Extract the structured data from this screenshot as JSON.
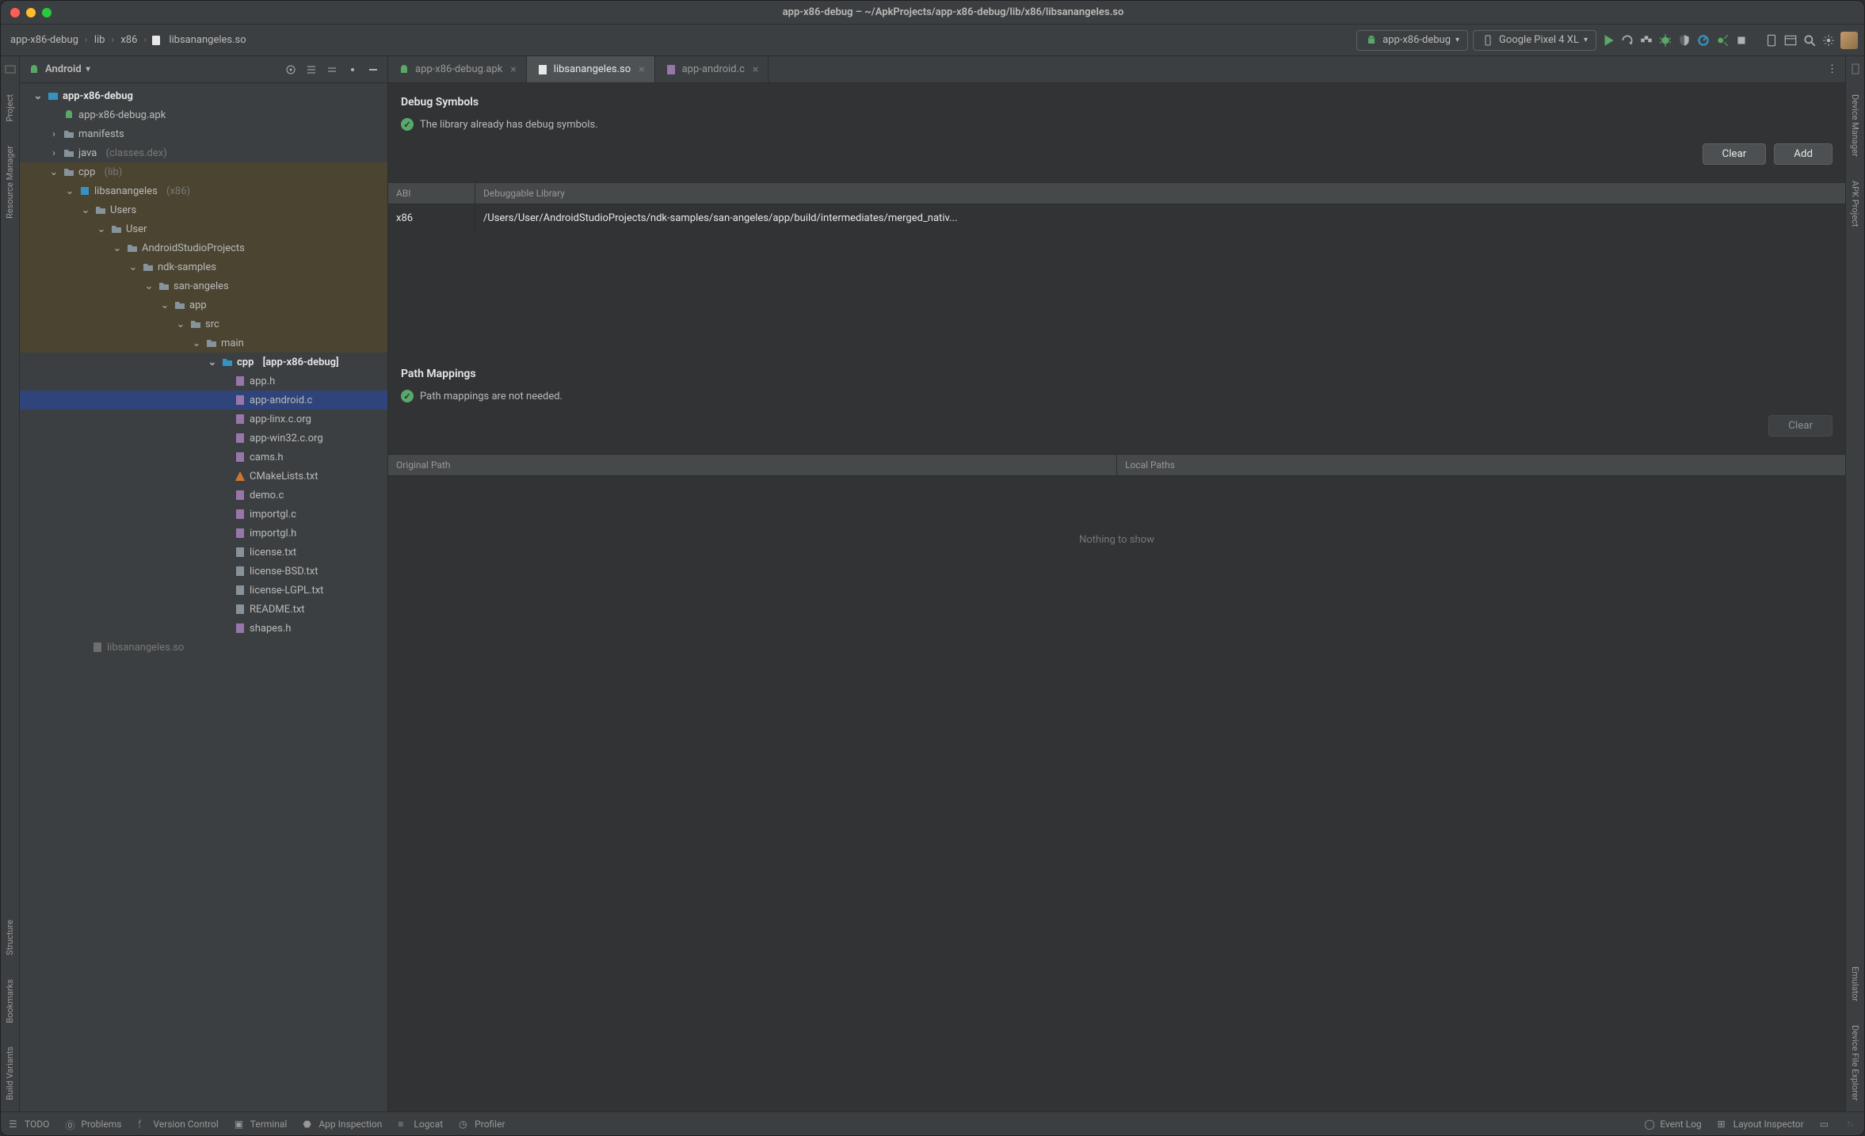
{
  "title": "app-x86-debug – ~/ApkProjects/app-x86-debug/lib/x86/libsanangeles.so",
  "breadcrumb": [
    "app-x86-debug",
    "lib",
    "x86",
    "libsanangeles.so"
  ],
  "runConfig": "app-x86-debug",
  "device": "Google Pixel 4 XL",
  "leftTabs": {
    "project": "Project",
    "resource": "Resource Manager",
    "structure": "Structure",
    "bookmarks": "Bookmarks",
    "build": "Build Variants"
  },
  "rightTabs": {
    "device": "Device Manager",
    "apk": "APK Project",
    "emulator": "Emulator",
    "explorer": "Device File Explorer"
  },
  "sidebar": {
    "dropdown": "Android"
  },
  "tree": {
    "root": "app-x86-debug",
    "apk": "app-x86-debug.apk",
    "manifests": "manifests",
    "java": "java",
    "javaDim": "(classes.dex)",
    "cpp": "cpp",
    "cppDim": "(lib)",
    "lib": "libsanangeles",
    "libDim": "(x86)",
    "users": "Users",
    "user": "User",
    "asp": "AndroidStudioProjects",
    "ndk": "ndk-samples",
    "san": "san-angeles",
    "app": "app",
    "src": "src",
    "main": "main",
    "cppFolder": "cpp",
    "cppFolderDim": "[app-x86-debug]",
    "files": [
      "app.h",
      "app-android.c",
      "app-linx.c.org",
      "app-win32.c.org",
      "cams.h",
      "CMakeLists.txt",
      "demo.c",
      "importgl.c",
      "importgl.h",
      "license.txt",
      "license-BSD.txt",
      "license-LGPL.txt",
      "README.txt",
      "shapes.h"
    ],
    "bottomLib": "libsanangeles.so"
  },
  "tabs": [
    {
      "label": "app-x86-debug.apk",
      "active": false
    },
    {
      "label": "libsanangeles.so",
      "active": true
    },
    {
      "label": "app-android.c",
      "active": false
    }
  ],
  "debugSymbols": {
    "title": "Debug Symbols",
    "status": "The library already has debug symbols.",
    "clear": "Clear",
    "add": "Add",
    "col1": "ABI",
    "col2": "Debuggable Library",
    "row": {
      "abi": "x86",
      "path": "/Users/User/AndroidStudioProjects/ndk-samples/san-angeles/app/build/intermediates/merged_nativ..."
    }
  },
  "pathMappings": {
    "title": "Path Mappings",
    "status": "Path mappings are not needed.",
    "clear": "Clear",
    "col1": "Original Path",
    "col2": "Local Paths",
    "empty": "Nothing to show"
  },
  "status": {
    "todo": "TODO",
    "problems": "Problems",
    "vcs": "Version Control",
    "terminal": "Terminal",
    "appInsp": "App Inspection",
    "logcat": "Logcat",
    "profiler": "Profiler",
    "eventLog": "Event Log",
    "layoutInsp": "Layout Inspector"
  }
}
